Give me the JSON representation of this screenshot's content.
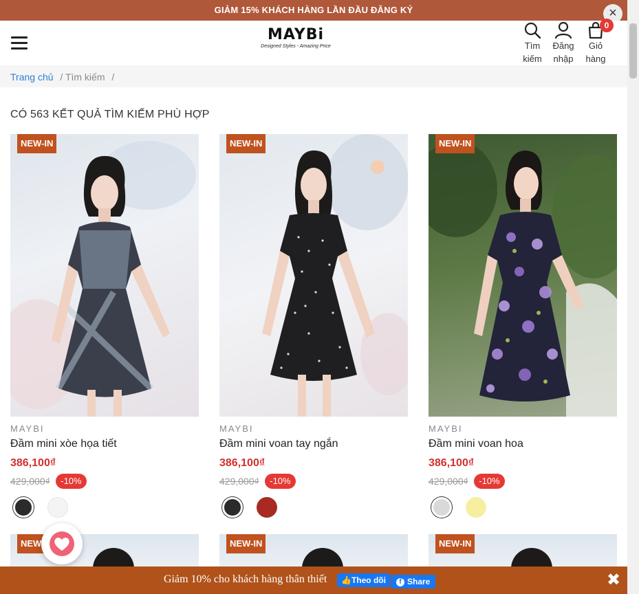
{
  "promo": {
    "text": "GIẢM 15% KHÁCH HÀNG LẦN ĐẦU ĐĂNG KÝ",
    "close": "×"
  },
  "header": {
    "logo": "MAYBi",
    "tagline": "Designed Styles - Amazing Price",
    "search_label_1": "Tìm",
    "search_label_2": "kiếm",
    "login_label_1": "Đăng",
    "login_label_2": "nhập",
    "cart_label_1": "Giỏ",
    "cart_label_2": "hàng",
    "cart_count": "0"
  },
  "breadcrumb": {
    "home": "Trang chủ",
    "sep1": "/",
    "current": "Tìm kiếm",
    "sep2": "/"
  },
  "results_title": "CÓ 563 KẾT QUẢ TÌM KIẾM PHÙ HỢP",
  "products": [
    {
      "badge": "NEW-IN",
      "brand": "MAYBI",
      "name": "Đầm mini xòe họa tiết",
      "price": "386,100₫",
      "old_price": "429,000₫",
      "discount": "-10%",
      "swatches": [
        "#2b2b2b",
        "#f4f4f4"
      ]
    },
    {
      "badge": "NEW-IN",
      "brand": "MAYBI",
      "name": "Đầm mini voan tay ngắn",
      "price": "386,100₫",
      "old_price": "429,000₫",
      "discount": "-10%",
      "swatches": [
        "#2b2b2b",
        "#a82a20"
      ]
    },
    {
      "badge": "NEW-IN",
      "brand": "MAYBI",
      "name": "Đầm mini voan hoa",
      "price": "386,100₫",
      "old_price": "429,000₫",
      "discount": "-10%",
      "swatches": [
        "#d9d9d9",
        "#f7efa0"
      ]
    }
  ],
  "next_row_badges": [
    "NEW",
    "NEW-IN",
    "NEW-IN"
  ],
  "bottom_bar": {
    "text": "Giảm 10% cho khách hàng thân thiết",
    "follow": "Theo dõi",
    "share": "Share",
    "close": "✖"
  },
  "colors": {
    "promo": "#b0583a",
    "accent_red": "#d32f2f",
    "badge": "#c0521f",
    "bottom": "#b0521a",
    "facebook": "#1877f2"
  }
}
